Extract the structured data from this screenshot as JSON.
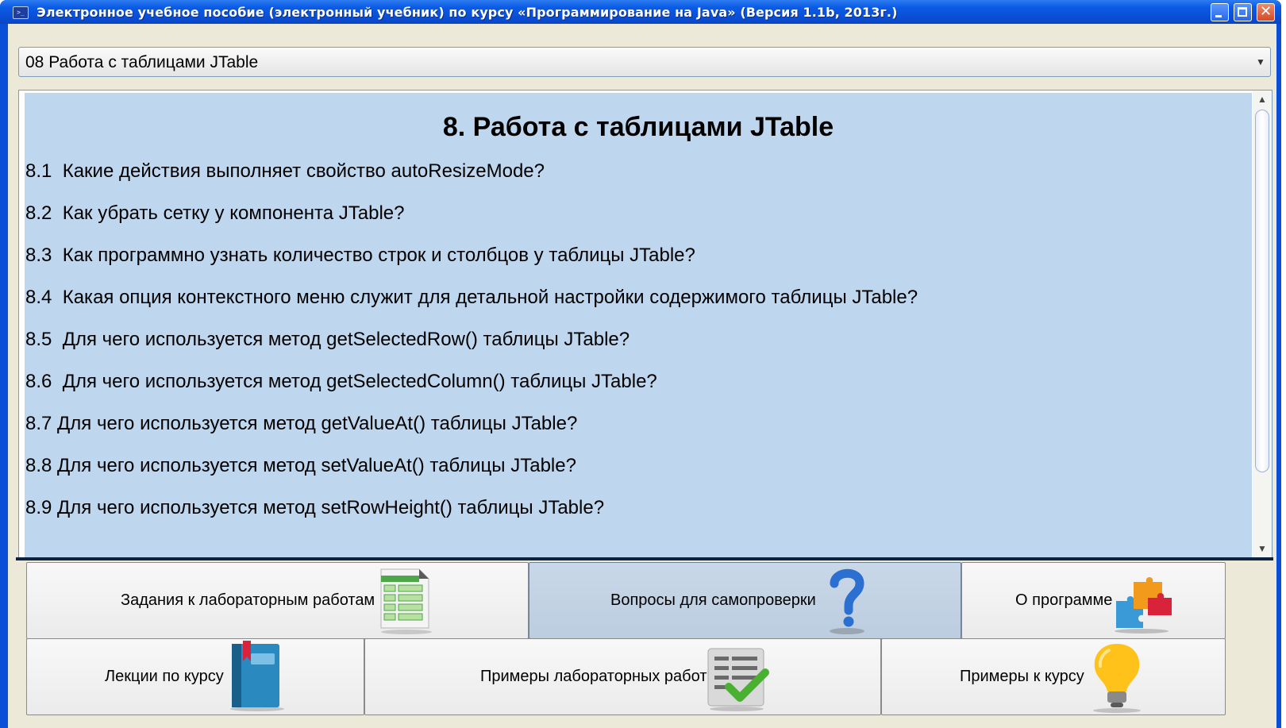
{
  "window": {
    "title": "Электронное учебное пособие (электронный учебник) по курсу «Программирование на Java»  (Версия 1.1b, 2013г.)",
    "app_icon": "terminal-icon",
    "controls": [
      "minimize-icon",
      "maximize-icon",
      "close-icon"
    ]
  },
  "topic_select": {
    "value": "08 Работа с таблицами JTable"
  },
  "content": {
    "heading": "8. Работа с таблицами JTable",
    "questions": [
      {
        "num": "8.1",
        "text": "Какие действия выполняет свойство autoResizeMode?"
      },
      {
        "num": "8.2",
        "text": "Как убрать сетку у компонента JTable?"
      },
      {
        "num": "8.3",
        "text": "Как программно узнать количество строк и столбцов у таблицы JTable?"
      },
      {
        "num": "8.4",
        "text": "Какая опция контекстного меню служит для детальной настройки содержимого таблицы JTable?"
      },
      {
        "num": "8.5",
        "text": "Для чего используется метод getSelectedRow() таблицы JTable?"
      },
      {
        "num": "8.6",
        "text": "Для чего используется метод getSelectedColumn() таблицы JTable?"
      },
      {
        "num": "8.7",
        "text": "Для чего используется метод getValueAt() таблицы JTable?"
      },
      {
        "num": "8.8",
        "text": "Для чего используется метод setValueAt() таблицы JTable?"
      },
      {
        "num": "8.9",
        "text": "Для чего используется метод setRowHeight() таблицы JTable?"
      }
    ]
  },
  "nav_buttons": {
    "lab_tasks": {
      "label": "Задания к лабораторным работам",
      "icon": "spreadsheet-icon"
    },
    "self_check": {
      "label": "Вопросы для самопроверки",
      "icon": "question-mark-icon",
      "active": true
    },
    "about": {
      "label": "О программе",
      "icon": "puzzle-icon"
    },
    "lectures": {
      "label": "Лекции по курсу",
      "icon": "book-icon"
    },
    "lab_examples": {
      "label": "Примеры лабораторных работ",
      "icon": "checklist-icon"
    },
    "course_examples": {
      "label": "Примеры к курсу",
      "icon": "lightbulb-icon"
    }
  },
  "colors": {
    "titlebar": "#0a5ce6",
    "content_bg": "#bed6ee",
    "active_button": "#c9d8e8"
  }
}
